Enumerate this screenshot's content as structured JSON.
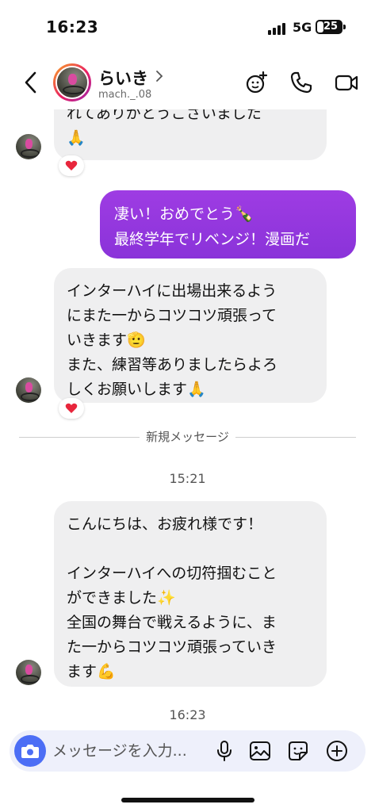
{
  "status_bar": {
    "time": "16:23",
    "network": "5G",
    "battery": "25"
  },
  "header": {
    "name": "らいき",
    "handle": "mach._.08",
    "icons": [
      "back-icon",
      "chevron-right-icon",
      "effects-icon",
      "phone-icon",
      "video-icon"
    ]
  },
  "messages": [
    {
      "side": "incoming",
      "text": "れてありがとうございました\n🙏",
      "reaction": "heart"
    },
    {
      "side": "outgoing",
      "text": "凄い！おめでとう🍾\n最終学年でリベンジ！漫画だ"
    },
    {
      "side": "incoming",
      "text": "インターハイに出場出来るよう\nにまた一からコツコツ頑張って\nいきます🫡\nまた、練習等ありましたらよろ\nしくお願いします🙏",
      "reaction": "heart"
    },
    {
      "side": "incoming",
      "text": "こんにちは、お疲れ様です！\n\nインターハイへの切符掴むこと\nができました✨\n全国の舞台で戦えるように、ま\nた一からコツコツ頑張っていき\nます💪"
    }
  ],
  "divider_label": "新規メッセージ",
  "timestamps": [
    "15:21",
    "16:23"
  ],
  "composer": {
    "placeholder": "メッセージを入力...",
    "icons": [
      "camera-icon",
      "mic-icon",
      "image-icon",
      "sticker-icon",
      "plus-icon"
    ]
  },
  "colors": {
    "outgoing_bubble": "#9438e0",
    "incoming_bubble": "#efeff0",
    "camera_button": "#4c6ef5"
  }
}
